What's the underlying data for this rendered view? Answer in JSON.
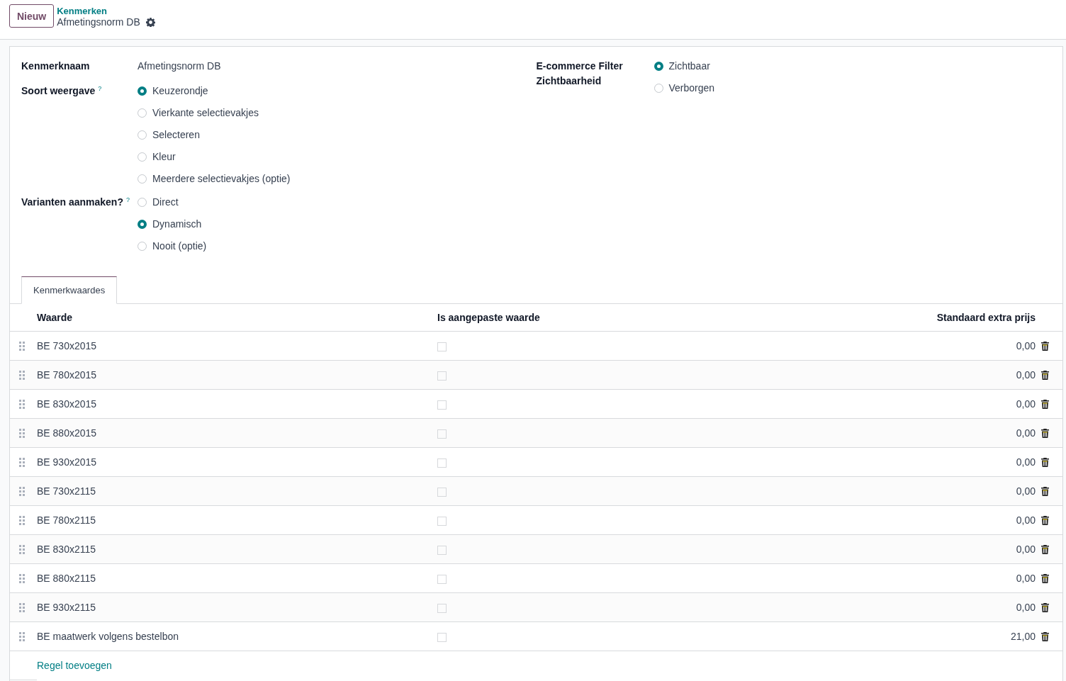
{
  "control_panel": {
    "new_button": "Nieuw",
    "breadcrumb_parent": "Kenmerken",
    "breadcrumb_current": "Afmetingsnorm DB"
  },
  "form": {
    "name": {
      "label": "Kenmerknaam",
      "value": "Afmetingsnorm DB"
    },
    "groups": [
      {
        "label": "Soort weergave",
        "help": "?",
        "options": [
          {
            "label": "Keuzerondje",
            "selected": true
          },
          {
            "label": "Vierkante selectievakjes",
            "selected": false
          },
          {
            "label": "Selecteren",
            "selected": false
          },
          {
            "label": "Kleur",
            "selected": false
          },
          {
            "label": "Meerdere selectievakjes (optie)",
            "selected": false
          }
        ]
      },
      {
        "label": "Varianten aanmaken?",
        "help": "?",
        "options": [
          {
            "label": "Direct",
            "selected": false
          },
          {
            "label": "Dynamisch",
            "selected": true
          },
          {
            "label": "Nooit (optie)",
            "selected": false
          }
        ]
      }
    ],
    "ecommerce": {
      "label": "E-commerce Filter Zichtbaarheid",
      "options": [
        {
          "label": "Zichtbaar",
          "selected": true
        },
        {
          "label": "Verborgen",
          "selected": false
        }
      ]
    }
  },
  "tabs": [
    {
      "label": "Kenmerkwaardes",
      "selected": true
    }
  ],
  "table": {
    "columns": [
      "Waarde",
      "Is aangepaste waarde",
      "Standaard extra prijs"
    ],
    "rows": [
      {
        "value": "BE 730x2015",
        "custom": false,
        "price": "0,00"
      },
      {
        "value": "BE 780x2015",
        "custom": false,
        "price": "0,00"
      },
      {
        "value": "BE 830x2015",
        "custom": false,
        "price": "0,00"
      },
      {
        "value": "BE 880x2015",
        "custom": false,
        "price": "0,00"
      },
      {
        "value": "BE 930x2015",
        "custom": false,
        "price": "0,00"
      },
      {
        "value": "BE 730x2115",
        "custom": false,
        "price": "0,00"
      },
      {
        "value": "BE 780x2115",
        "custom": false,
        "price": "0,00"
      },
      {
        "value": "BE 830x2115",
        "custom": false,
        "price": "0,00"
      },
      {
        "value": "BE 880x2115",
        "custom": false,
        "price": "0,00"
      },
      {
        "value": "BE 930x2115",
        "custom": false,
        "price": "0,00"
      },
      {
        "value": "BE maatwerk volgens bestelbon",
        "custom": false,
        "price": "21,00"
      }
    ],
    "add_line": "Regel toevoegen"
  }
}
